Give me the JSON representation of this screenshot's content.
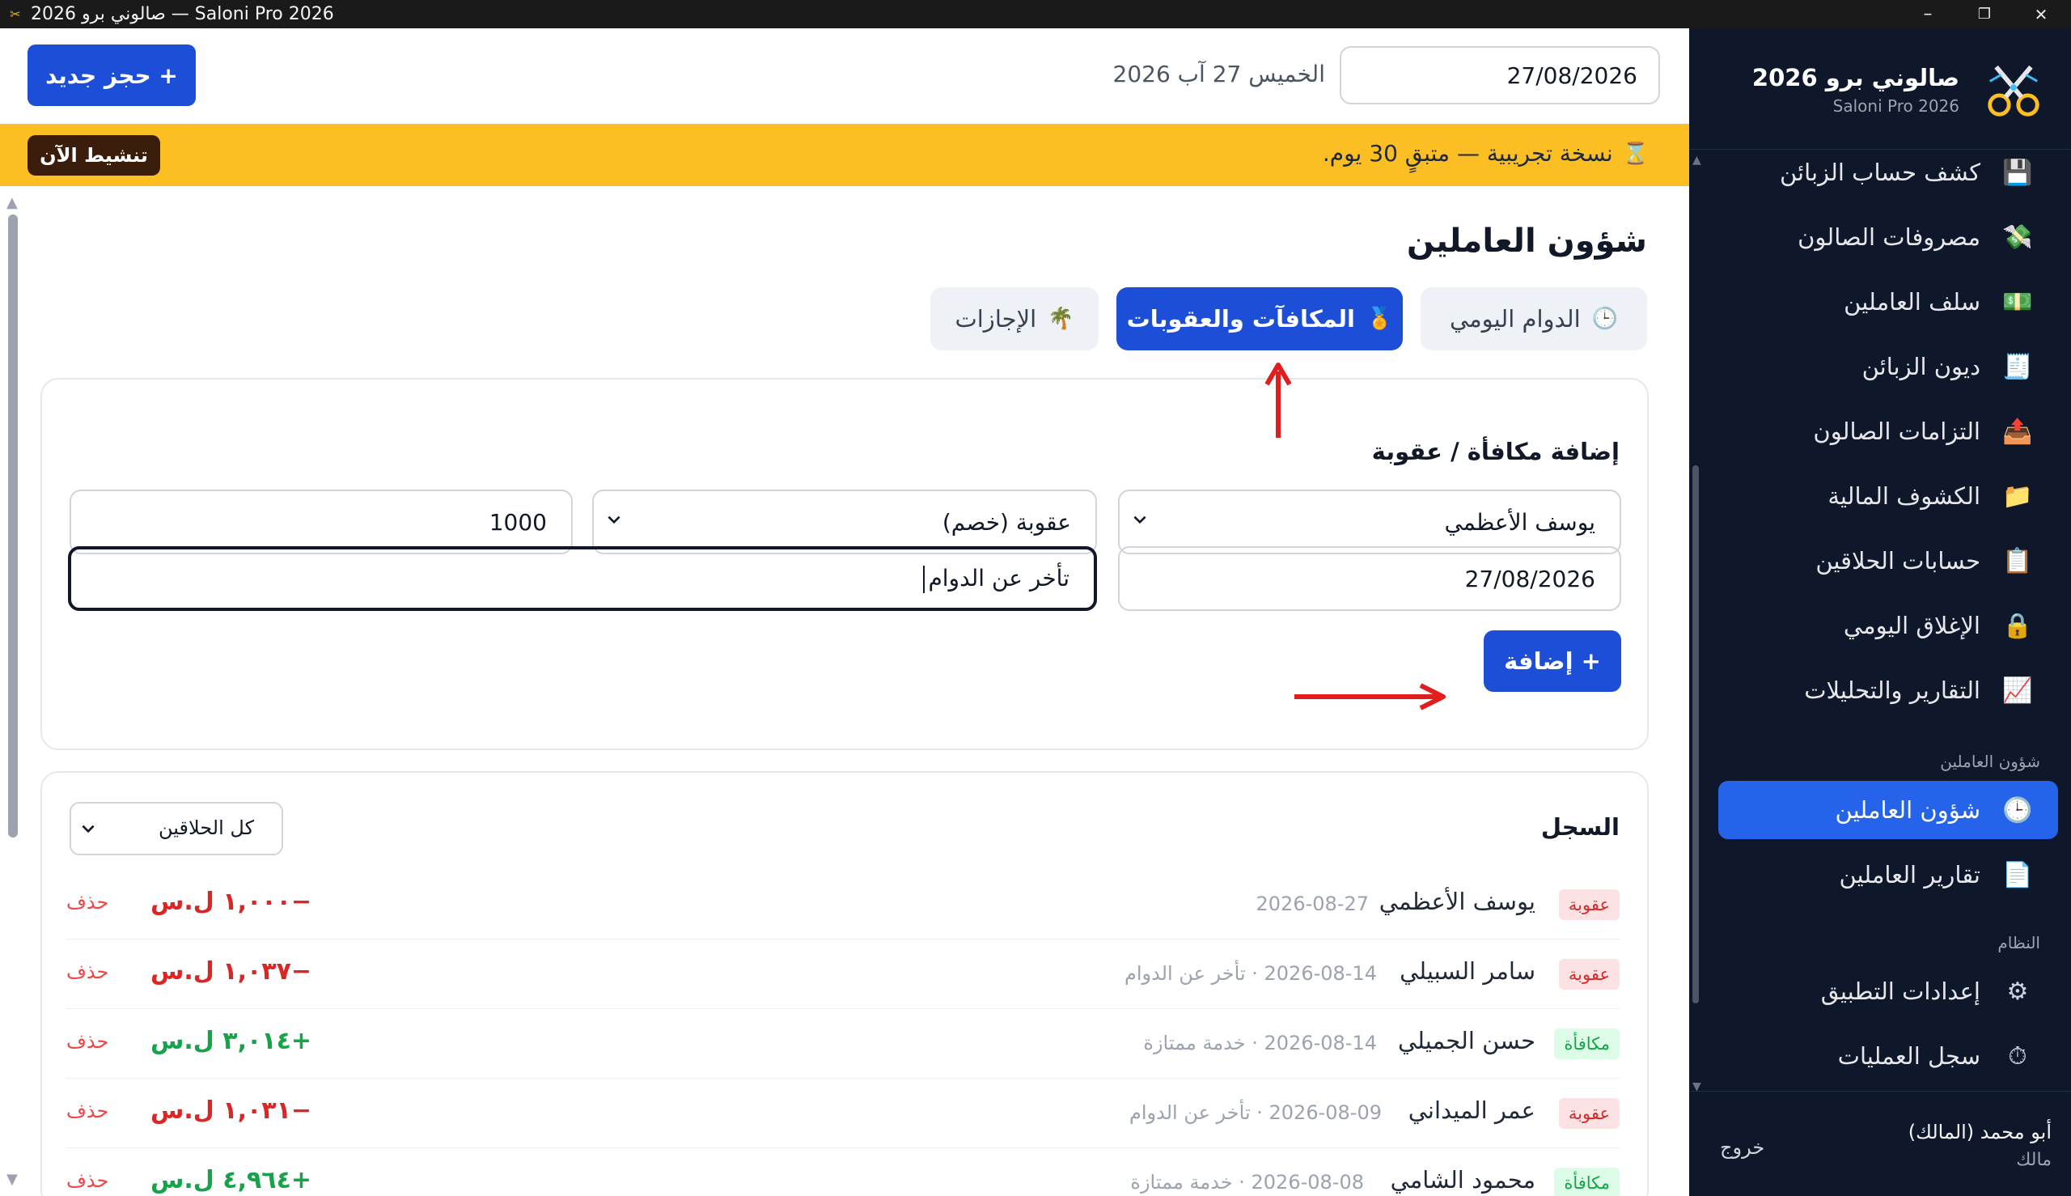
{
  "window": {
    "title": "صالوني برو 2026 — Saloni Pro 2026",
    "minimize_glyph": "–",
    "maximize_glyph": "❐",
    "close_glyph": "✕"
  },
  "sidebar": {
    "brand_name": "صالوني برو 2026",
    "brand_sub": "Saloni Pro 2026",
    "items": [
      {
        "label": "كشف حساب الزبائن",
        "icon": "floppy-disk-icon",
        "glyph": "💾"
      },
      {
        "label": "مصروفات الصالون",
        "icon": "money-flying-icon",
        "glyph": "💸"
      },
      {
        "label": "سلف العاملين",
        "icon": "banknote-icon",
        "glyph": "💵"
      },
      {
        "label": "ديون الزبائن",
        "icon": "receipt-icon",
        "glyph": "🧾"
      },
      {
        "label": "التزامات الصالون",
        "icon": "outbox-tray-icon",
        "glyph": "📤"
      },
      {
        "label": "الكشوف المالية",
        "icon": "folder-icon",
        "glyph": "📁"
      },
      {
        "label": "حسابات الحلاقين",
        "icon": "clipboard-icon",
        "glyph": "📋"
      },
      {
        "label": "الإغلاق اليومي",
        "icon": "lock-icon",
        "glyph": "🔒"
      },
      {
        "label": "التقارير والتحليلات",
        "icon": "chart-increasing-icon",
        "glyph": "📈"
      }
    ],
    "section_staff": "شؤون العاملين",
    "staff_items": [
      {
        "label": "شؤون العاملين",
        "icon": "clock-icon",
        "glyph": "🕒"
      },
      {
        "label": "تقارير العاملين",
        "icon": "page-icon",
        "glyph": "📄"
      }
    ],
    "section_system": "النظام",
    "system_items": [
      {
        "label": "إعدادات التطبيق",
        "icon": "gear-icon",
        "glyph": "⚙"
      },
      {
        "label": "سجل العمليات",
        "icon": "stopwatch-icon",
        "glyph": "⏱"
      }
    ],
    "user_name": "أبو محمد (المالك)",
    "user_role": "مالك",
    "logout": "خروج"
  },
  "topbar": {
    "date_value": "27/08/2026",
    "date_label": "الخميس 27 آب 2026",
    "new_booking": "+ حجز جديد"
  },
  "banner": {
    "text": "نسخة تجريبية — متبقٍ 30 يوم.",
    "icon": "hourglass-icon",
    "activate": "تنشيط الآن",
    "color": "#fbbf24"
  },
  "page": {
    "title": "شؤون العاملين",
    "tabs": [
      {
        "label": "الدوام اليومي",
        "icon": "clock-icon",
        "glyph": "🕒"
      },
      {
        "label": "المكافآت والعقوبات",
        "icon": "medal-icon",
        "glyph": "🏅"
      },
      {
        "label": "الإجازات",
        "icon": "palm-tree-icon",
        "glyph": "🌴"
      }
    ]
  },
  "form": {
    "title": "إضافة مكافأة / عقوبة",
    "employee": "يوسف الأعظمي",
    "type": "عقوبة (خصم)",
    "amount": "1000",
    "date": "27/08/2026",
    "note": "تأخر عن الدوام",
    "submit": "+ إضافة"
  },
  "log": {
    "title": "السجل",
    "filter": "كل الحلاقين",
    "delete_label": "حذف",
    "rows": [
      {
        "type": "عقوبة",
        "kind": "penalty",
        "name": "يوسف الأعظمي",
        "meta": "2026-08-27",
        "amount": "−١,٠٠٠ ل.س"
      },
      {
        "type": "عقوبة",
        "kind": "penalty",
        "name": "سامر السبيلي",
        "meta": "2026-08-14 · تأخر عن الدوام",
        "amount": "−١,٠٣٧ ل.س"
      },
      {
        "type": "مكافأة",
        "kind": "bonus",
        "name": "حسن الجميلي",
        "meta": "2026-08-14 · خدمة ممتازة",
        "amount": "+٣,٠١٤ ل.س"
      },
      {
        "type": "عقوبة",
        "kind": "penalty",
        "name": "عمر الميداني",
        "meta": "2026-08-09 · تأخر عن الدوام",
        "amount": "−١,٠٣١ ل.س"
      },
      {
        "type": "مكافأة",
        "kind": "bonus",
        "name": "محمود الشامي",
        "meta": "2026-08-08 · خدمة ممتازة",
        "amount": "+٤,٩٦٤ ل.س"
      }
    ]
  },
  "colors": {
    "accent": "#1d4ed8",
    "sidebar_bg": "#0f172a",
    "penalty": "#dc2626",
    "bonus": "#16a34a",
    "annotation_arrow": "#e11d1d"
  }
}
